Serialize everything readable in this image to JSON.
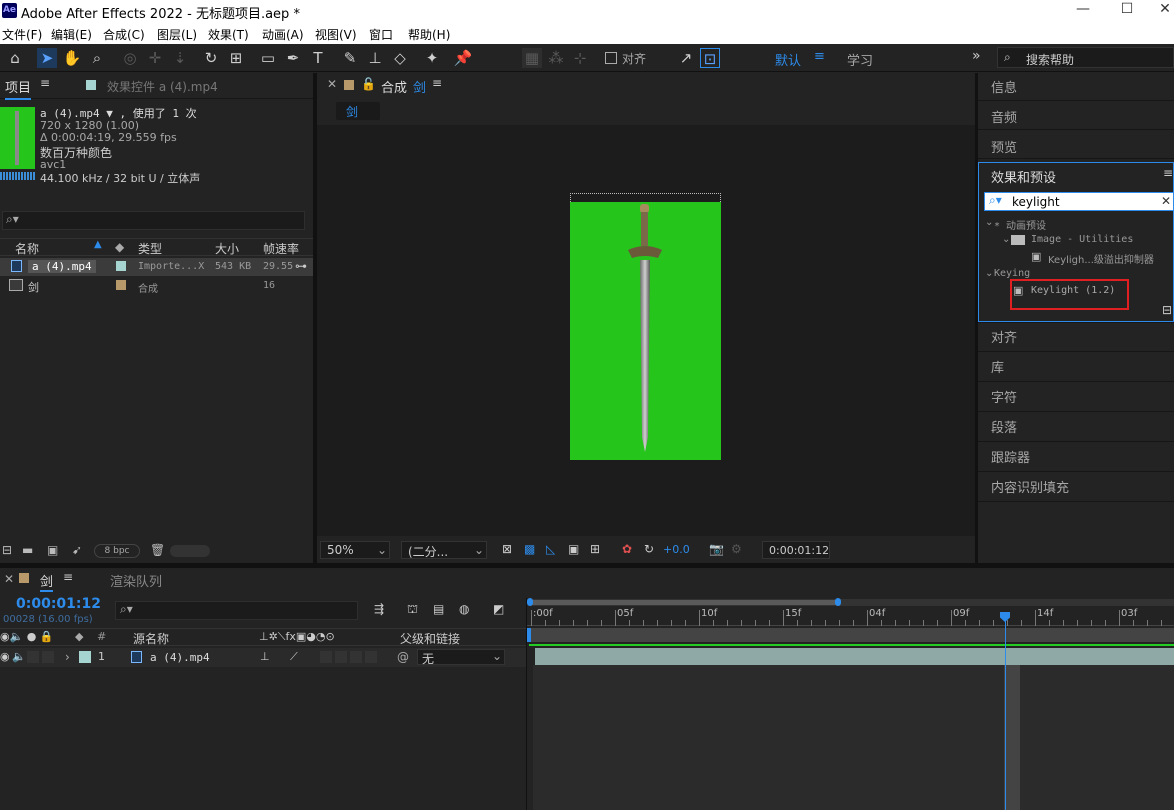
{
  "window": {
    "app_icon": "Ae",
    "title": "Adobe After Effects 2022 - 无标题项目.aep *",
    "minimize_glyph": "—",
    "maximize_glyph": "☐",
    "close_glyph": "✕"
  },
  "menu": [
    "文件(F)",
    "编辑(E)",
    "合成(C)",
    "图层(L)",
    "效果(T)",
    "动画(A)",
    "视图(V)",
    "窗口",
    "帮助(H)"
  ],
  "toolbar": {
    "align_label": "对齐",
    "workspace_default": "默认",
    "workspace_learn": "学习",
    "search_help": "搜索帮助",
    "more_glyph": "»"
  },
  "project_panel": {
    "tab_project": "项目",
    "tab_effect_controls": "效果控件 a (4).mp4",
    "item_name": "a (4).mp4 ▼ , 使用了 1 次",
    "item_dims": "720 x 1280 (1.00)",
    "item_duration": "Δ 0:00:04:19, 29.559 fps",
    "item_colors": "数百万种颜色",
    "item_codec": "avc1",
    "item_audio": "44.100 kHz / 32 bit U / 立体声",
    "col_name": "名称",
    "col_type": "类型",
    "col_size": "大小",
    "col_fps": "帧速率",
    "rows": [
      {
        "name": "a (4).mp4",
        "type": "Importe...X",
        "size": "543 KB",
        "fps": "29.55",
        "color": "#a6d4d1"
      },
      {
        "name": "剑",
        "type": "合成",
        "size": "",
        "fps": "16",
        "color": "#b89a6a"
      }
    ],
    "bpc": "8 bpc"
  },
  "composition_panel": {
    "tab_label": "合成",
    "comp_name": "剑",
    "breadcrumb": "剑",
    "zoom": "50%",
    "resolution": "(二分...",
    "exposure": "+0.0",
    "timecode": "0:00:01:12",
    "bg_color": "#25c51b"
  },
  "right_panel": {
    "info": "信息",
    "audio": "音频",
    "preview": "预览",
    "effects_presets": "效果和预设",
    "search_value": "keylight",
    "tree_presets": "* 动画预设",
    "tree_image_utilities": "Image - Utilities",
    "tree_keylight_spill": "Keyligh...级溢出抑制器",
    "tree_keying": "Keying",
    "tree_keylight": "Keylight (1.2)",
    "align": "对齐",
    "library": "库",
    "character": "字符",
    "paragraph": "段落",
    "tracker": "跟踪器",
    "content_aware_fill": "内容识别填充"
  },
  "timeline": {
    "tab_comp": "剑",
    "tab_render_queue": "渲染队列",
    "current_time": "0:00:01:12",
    "frame_info": "00028 (16.00 fps)",
    "col_source_name": "源名称",
    "col_parent": "父级和链接",
    "col_num": "#",
    "layer_num": "1",
    "layer_name": "a (4).mp4",
    "layer_parent": "无",
    "layer_label_color": "#a6d4d1",
    "ruler": [
      ":00f",
      "05f",
      "10f",
      "15f",
      "04f",
      "09f",
      "14f",
      "03f"
    ],
    "playhead_time_fraction": 0.737
  }
}
